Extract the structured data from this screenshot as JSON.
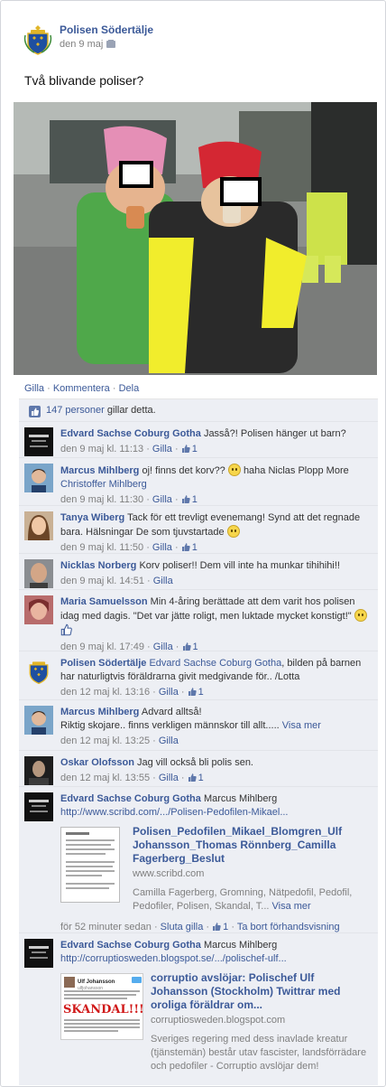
{
  "post": {
    "page_name": "Polisen Södertälje",
    "date": "den 9 maj",
    "text": "Två blivande poliser?",
    "actions": [
      "Gilla",
      "Kommentera",
      "Dela"
    ],
    "action_sep": "·",
    "likes_text": "147 personer gillar detta.",
    "likes_count": "147 personer",
    "likes_suffix": "gillar detta."
  },
  "comments": [
    {
      "author": "Edvard Sachse Coburg Gotha",
      "text": "Jasså?! Polisen hänger ut barn?",
      "time": "den 9 maj kl. 11:13",
      "like_label": "Gilla",
      "likes": "1"
    },
    {
      "author": "Marcus Mihlberg",
      "text": "oj! finns det korv??",
      "text2": "haha Niclas Plopp More",
      "mention": "Christoffer Mihlberg",
      "time": "den 9 maj kl. 11:30",
      "like_label": "Gilla",
      "likes": "1"
    },
    {
      "author": "Tanya Wiberg",
      "text": "Tack för ett trevligt evenemang! Synd att det regnade bara. Hälsningar De som tjuvstartade",
      "time": "den 9 maj kl. 11:50",
      "like_label": "Gilla",
      "likes": "1"
    },
    {
      "author": "Nicklas Norberg",
      "text": "Korv poliser!! Dem vill inte ha munkar tihihihi!!",
      "time": "den 9 maj kl. 14:51",
      "like_label": "Gilla"
    },
    {
      "author": "Maria Samuelsson",
      "text": "Min 4-åring berättade att dem varit hos polisen idag med dagis. \"Det var jätte roligt, men luktade mycket konstigt!\"",
      "time": "den 9 maj kl. 17:49",
      "like_label": "Gilla",
      "likes": "1"
    },
    {
      "author": "Polisen Södertälje",
      "mention": "Edvard Sachse Coburg Gotha",
      "text": ", bilden på barnen har naturligtvis föräldrarna givit medgivande för.. /Lotta",
      "time": "den 12 maj kl. 13:16",
      "like_label": "Gilla",
      "likes": "1"
    },
    {
      "author": "Marcus Mihlberg",
      "text": "Advard alltså!",
      "text2": "Riktig skojare.. finns verkligen männskor till allt.....",
      "see_more": "Visa mer",
      "time": "den 12 maj kl. 13:25",
      "like_label": "Gilla"
    },
    {
      "author": "Oskar Olofsson",
      "text": "Jag vill också bli polis sen.",
      "time": "den 12 maj kl. 13:55",
      "like_label": "Gilla",
      "likes": "1"
    },
    {
      "author": "Edvard Sachse Coburg Gotha",
      "text": "Marcus Mihlberg",
      "link": "http://www.scribd.com/.../Polisen-Pedofilen-Mikael...",
      "share_title": "Polisen_Pedofilen_Mikael_Blomgren_Ulf Johansson_Thomas Rönnberg_Camilla Fagerberg_Beslut",
      "share_domain": "www.scribd.com",
      "share_desc": "Camilla Fagerberg, Gromning, Nätpedofil, Pedofil, Pedofiler, Polisen, Skandal, T...",
      "share_more": "Visa mer",
      "time": "för 52 minuter sedan",
      "like_label": "Sluta gilla",
      "likes": "1",
      "remove_label": "Ta bort förhandsvisning"
    },
    {
      "author": "Edvard Sachse Coburg Gotha",
      "text": "Marcus Mihlberg",
      "link": "http://corruptiosweden.blogspot.se/.../polischef-ulf...",
      "share_title": "corruptio avslöjar: Polischef Ulf Johansson (Stockholm) Twittrar med oroliga föräldrar om...",
      "share_domain": "corruptiosweden.blogspot.com",
      "share_desc": "Sveriges regering med dess inavlade kreatur (tjänstemän) består utav fascister, landsförrädare och pedofiler - Corruptio avslöjar dem!",
      "thumb_name": "Ulf Johansson",
      "thumb_handle": "ulfjohansson",
      "thumb_badge": "SKANDAL!!!"
    }
  ],
  "colors": {
    "link": "#3b5998",
    "ufi_bg": "#edeff4",
    "meta": "#7f7f7f"
  }
}
